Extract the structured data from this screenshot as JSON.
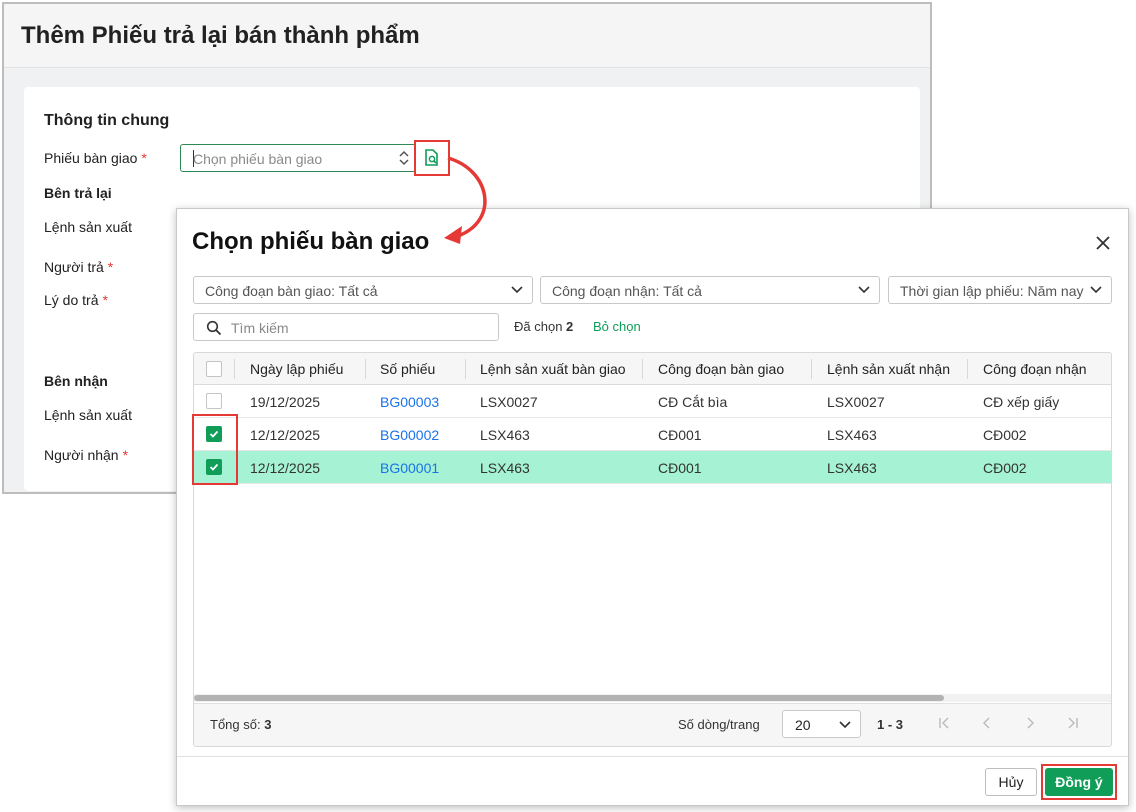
{
  "form": {
    "title": "Thêm Phiếu trả lại bán thành phẩm",
    "section_general": "Thông tin chung",
    "handover_label": "Phiếu bàn giao",
    "handover_placeholder": "Chọn phiếu bàn giao",
    "required_mark": "*",
    "return_side": "Bên trả lại",
    "production_order_label": "Lệnh sản xuất",
    "returner_label": "Người trả",
    "reason_label": "Lý do trả",
    "receive_side": "Bên nhận",
    "production_order_label_2": "Lệnh sản xuất",
    "receiver_label": "Người nhận"
  },
  "dialog": {
    "title": "Chọn phiếu bàn giao",
    "filters": [
      "Công đoạn bàn giao: Tất cả",
      "Công đoạn nhận: Tất cả",
      "Thời gian lập phiếu: Năm nay"
    ],
    "search_placeholder": "Tìm kiếm",
    "selected_label": "Đã chọn",
    "selected_count": "2",
    "deselect_label": "Bỏ chọn",
    "columns": [
      "Ngày lập phiếu",
      "Số phiếu",
      "Lệnh sản xuất bàn giao",
      "Công đoạn bàn giao",
      "Lệnh sản xuất nhận",
      "Công đoạn nhận"
    ],
    "rows": [
      {
        "checked": false,
        "date": "19/12/2025",
        "number": "BG00003",
        "from_order": "LSX0027",
        "from_stage": "CĐ Cắt bìa",
        "to_order": "LSX0027",
        "to_stage": "CĐ xếp giấy"
      },
      {
        "checked": true,
        "date": "12/12/2025",
        "number": "BG00002",
        "from_order": "LSX463",
        "from_stage": "CĐ001",
        "to_order": "LSX463",
        "to_stage": "CĐ002"
      },
      {
        "checked": true,
        "date": "12/12/2025",
        "number": "BG00001",
        "from_order": "LSX463",
        "from_stage": "CĐ001",
        "to_order": "LSX463",
        "to_stage": "CĐ002"
      }
    ],
    "total_label": "Tổng số:",
    "total_value": "3",
    "rows_per_page_label": "Số dòng/trang",
    "page_size": "20",
    "range": "1 - 3",
    "cancel_label": "Hủy",
    "ok_label": "Đồng ý"
  },
  "colors": {
    "accent": "#0f9d58",
    "highlight": "#e53935",
    "selected_row": "#a6f2d4",
    "link": "#1a73e8"
  }
}
